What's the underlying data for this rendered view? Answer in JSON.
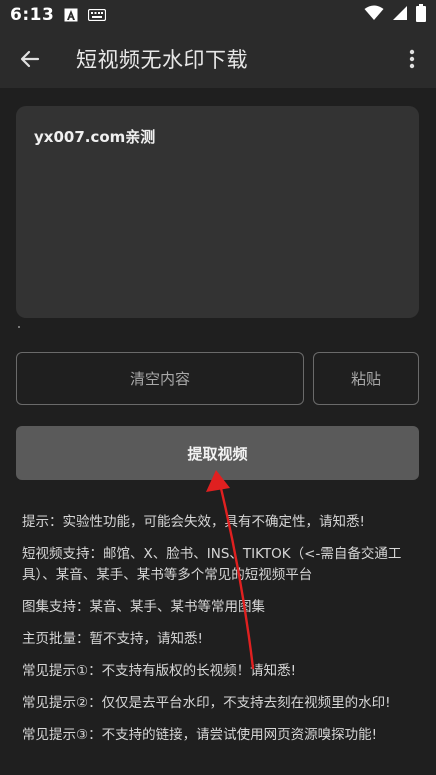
{
  "status_bar": {
    "time": "6:13"
  },
  "app_bar": {
    "title": "短视频无水印下载"
  },
  "input": {
    "value": "yx007.com亲测"
  },
  "buttons": {
    "clear_label": "清空内容",
    "paste_label": "粘贴",
    "extract_label": "提取视频"
  },
  "tips": [
    "提示：实验性功能，可能会失效，具有不确定性，请知悉!",
    "短视频支持：邮馆、X、脸书、INS、TIKTOK（<-需自备交通工具）、某音、某手、某书等多个常见的短视频平台",
    "图集支持：某音、某手、某书等常用图集",
    "主页批量：暂不支持，请知悉!",
    "常见提示①：不支持有版权的长视频！请知悉!",
    "常见提示②：仅仅是去平台水印，不支持去刻在视频里的水印!",
    "常见提示③：不支持的链接，请尝试使用网页资源嗅探功能!"
  ],
  "colors": {
    "background": "#1f1f1f",
    "bar": "#2b2b2b",
    "input_bg": "#333333",
    "extract_btn": "#5a5a5a",
    "annotation_arrow": "#e02020"
  }
}
